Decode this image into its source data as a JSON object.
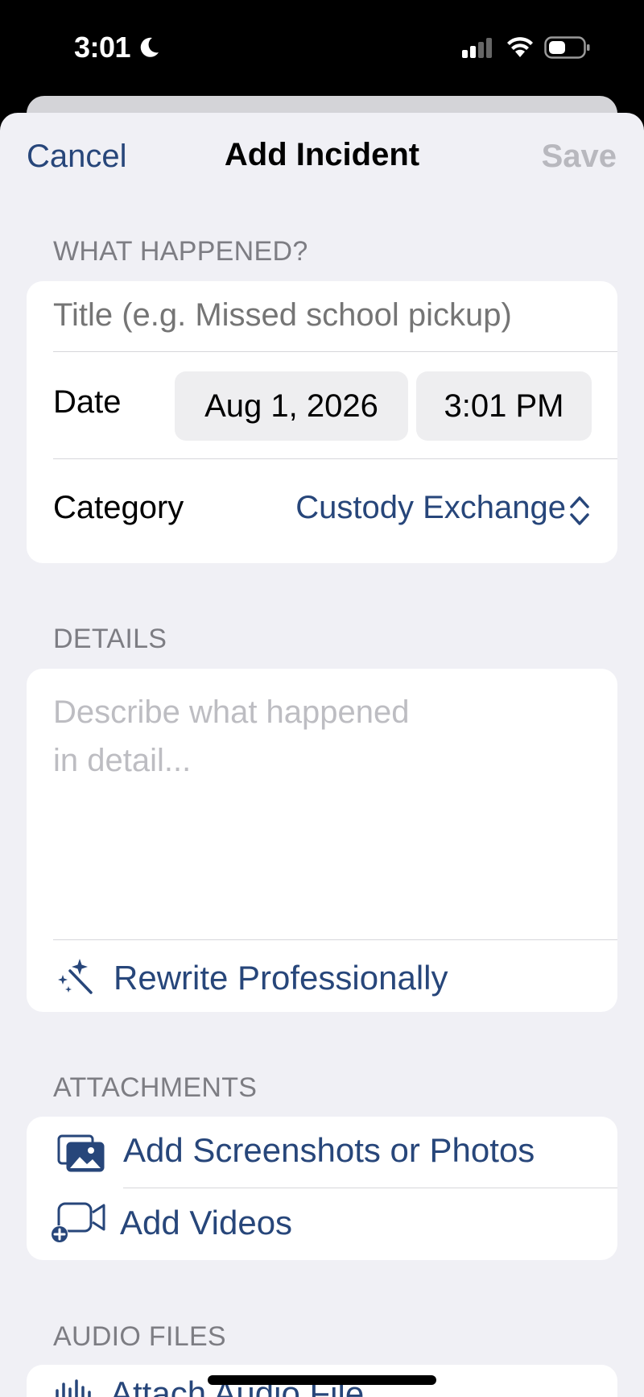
{
  "status_bar": {
    "time": "3:01"
  },
  "nav": {
    "cancel_label": "Cancel",
    "title": "Add Incident",
    "save_label": "Save"
  },
  "what_happened": {
    "header": "WHAT HAPPENED?",
    "title_placeholder": "Title (e.g. Missed school pickup)",
    "date_label": "Date",
    "date_value": "Aug 1, 2026",
    "time_value": "3:01 PM",
    "category_label": "Category",
    "category_value": "Custody Exchange"
  },
  "details": {
    "header": "DETAILS",
    "placeholder_line1": "Describe what happened",
    "placeholder_line2": "in detail...",
    "rewrite_label": "Rewrite Professionally"
  },
  "attachments": {
    "header": "ATTACHMENTS",
    "photos_label": "Add Screenshots or Photos",
    "videos_label": "Add Videos"
  },
  "audio": {
    "header": "AUDIO FILES",
    "attach_label": "Attach Audio File"
  },
  "colors": {
    "accent": "#27467a",
    "background": "#f0f0f5",
    "placeholder": "#bdbdc2",
    "section_header": "#7d7d83",
    "disabled": "#b8b8be"
  },
  "icons": [
    "moon-icon",
    "signal-icon",
    "wifi-icon",
    "battery-icon",
    "chevron-updown-icon",
    "magic-wand-icon",
    "photo-stack-icon",
    "video-add-icon",
    "waveform-icon"
  ]
}
